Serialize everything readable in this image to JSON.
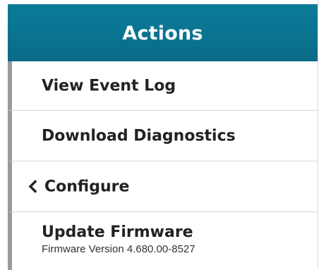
{
  "panel": {
    "title": "Actions",
    "accent_color": "#0a7592",
    "items": [
      {
        "label": "View Event Log"
      },
      {
        "label": "Download Diagnostics"
      },
      {
        "label": "Configure",
        "icon": "chevron-left-icon"
      },
      {
        "label": "Update Firmware",
        "sublabel": "Firmware Version 4.680.00-8527"
      }
    ]
  }
}
